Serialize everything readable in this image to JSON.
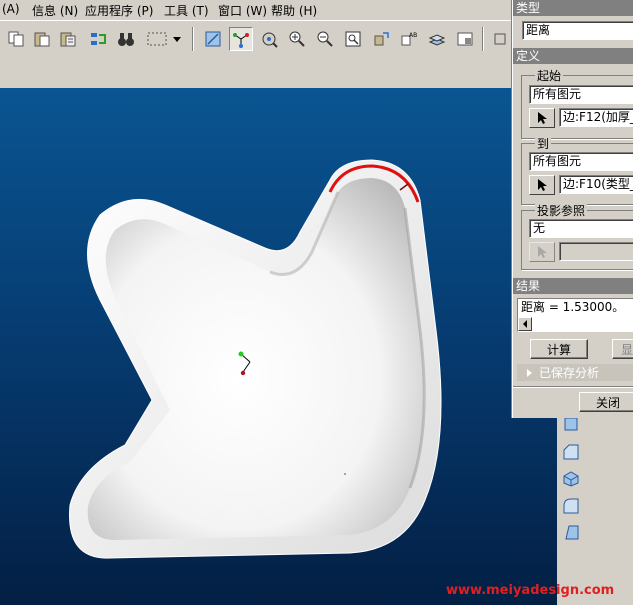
{
  "menu": {
    "items": [
      {
        "label": "(A)"
      },
      {
        "label": "信息 (N)"
      },
      {
        "label": "应用程序 (P)"
      },
      {
        "label": "工具 (T)"
      },
      {
        "label": "窗口 (W)"
      },
      {
        "label": "帮助 (H)"
      }
    ]
  },
  "dialog": {
    "type_header": "类型",
    "type_value": "距离",
    "definition_header": "定义",
    "from": {
      "title": "起始",
      "filter": "所有图元",
      "selection": "边:F12(加厚_"
    },
    "to": {
      "title": "到",
      "filter": "所有图元",
      "selection": "边:F10(类型_"
    },
    "projection": {
      "title": "投影参照",
      "value": "无",
      "selection": ""
    },
    "result_header": "结果",
    "result_text": "距离 = 1.53000。",
    "compute_label": "计算",
    "show_label": "显",
    "saved_analysis_label": "已保存分析",
    "close_label": "关闭"
  },
  "watermark": "www.meiyadesign.com",
  "colors": {
    "viewport_top": "#0a5592",
    "viewport_bottom": "#031f44",
    "highlight_edge": "#e01010",
    "watermark": "#e02020"
  },
  "icons": {
    "toolbar": [
      "copy-icon",
      "paste-icon",
      "paste-special-icon",
      "regenerate-icon",
      "binoculars-icon",
      "select-box-icon",
      "dropdown-arrow-icon",
      "repaint-icon",
      "spin-center-icon",
      "orient-icon",
      "zoom-in-icon",
      "zoom-out-icon",
      "refit-icon",
      "view-manager-icon",
      "annotation-icon",
      "layers-icon",
      "saved-views-icon"
    ],
    "side": [
      "shade-icon",
      "chamfer-icon",
      "extrude-icon",
      "round-icon",
      "draft-icon"
    ]
  }
}
